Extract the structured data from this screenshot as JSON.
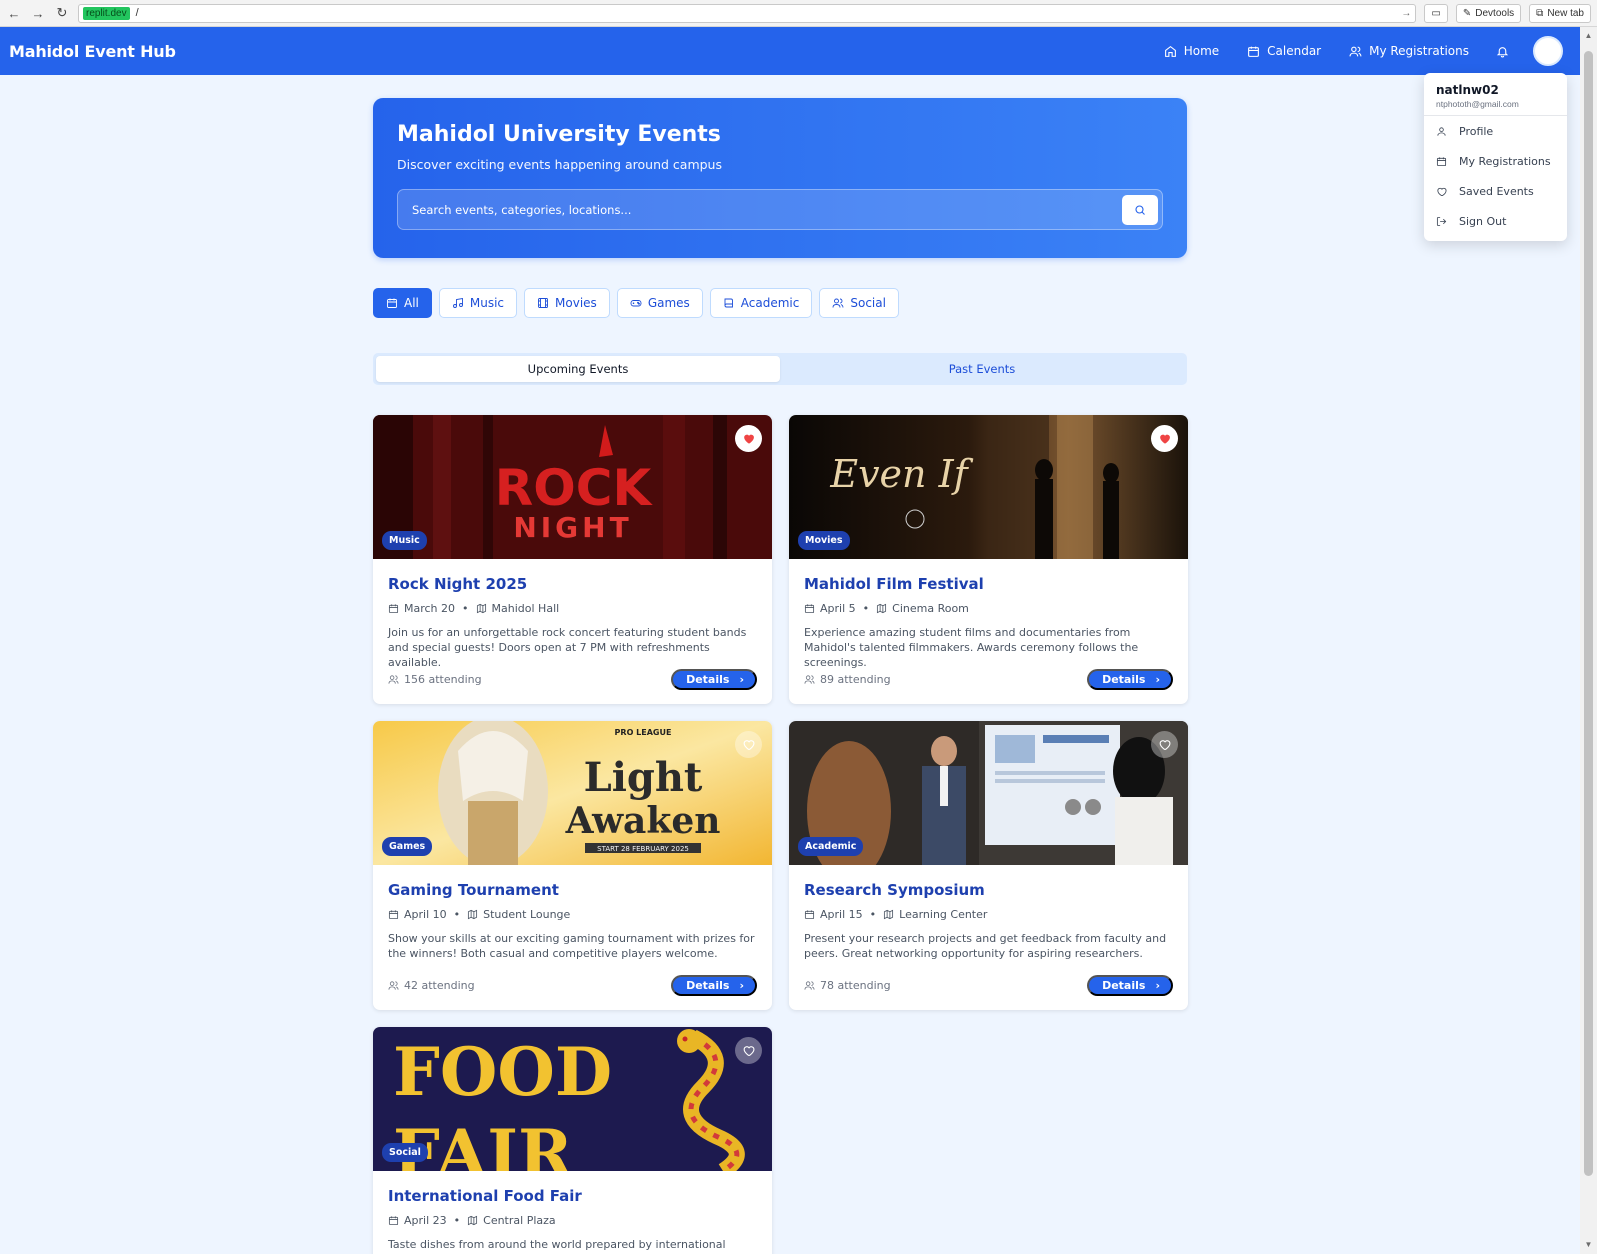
{
  "browser": {
    "url_host": "replit.dev",
    "url_path": "/",
    "devtools_label": "Devtools",
    "newtab_label": "New tab"
  },
  "header": {
    "brand": "Mahidol Event Hub",
    "nav": [
      {
        "label": "Home",
        "icon": "home-icon"
      },
      {
        "label": "Calendar",
        "icon": "calendar-icon"
      },
      {
        "label": "My Registrations",
        "icon": "users-icon"
      }
    ]
  },
  "hero": {
    "title": "Mahidol University Events",
    "subtitle": "Discover exciting events happening around campus",
    "search_placeholder": "Search events, categories, locations..."
  },
  "categories": [
    {
      "label": "All",
      "active": true
    },
    {
      "label": "Music"
    },
    {
      "label": "Movies"
    },
    {
      "label": "Games"
    },
    {
      "label": "Academic"
    },
    {
      "label": "Social"
    }
  ],
  "tabs": [
    {
      "label": "Upcoming Events",
      "active": true
    },
    {
      "label": "Past Events"
    }
  ],
  "events": [
    {
      "title": "Rock Night 2025",
      "category": "Music",
      "date": "March 20",
      "location": "Mahidol Hall",
      "description": "Join us for an unforgettable rock concert featuring student bands and special guests! Doors open at 7 PM with refreshments available.",
      "attending": "156 attending",
      "saved": true,
      "details_label": "Details",
      "image_text": [
        "ROCK",
        "NIGHT"
      ]
    },
    {
      "title": "Mahidol Film Festival",
      "category": "Movies",
      "date": "April 5",
      "location": "Cinema Room",
      "description": "Experience amazing student films and documentaries from Mahidol's talented filmmakers. Awards ceremony follows the screenings.",
      "attending": "89 attending",
      "saved": true,
      "details_label": "Details",
      "image_text": [
        "Even If"
      ]
    },
    {
      "title": "Gaming Tournament",
      "category": "Games",
      "date": "April 10",
      "location": "Student Lounge",
      "description": "Show your skills at our exciting gaming tournament with prizes for the winners! Both casual and competitive players welcome.",
      "attending": "42 attending",
      "saved": false,
      "details_label": "Details",
      "image_text": [
        "PRO LEAGUE",
        "Light",
        "Awaken",
        "START 28 FEBRUARY 2025"
      ]
    },
    {
      "title": "Research Symposium",
      "category": "Academic",
      "date": "April 15",
      "location": "Learning Center",
      "description": "Present your research projects and get feedback from faculty and peers. Great networking opportunity for aspiring researchers.",
      "attending": "78 attending",
      "saved": false,
      "details_label": "Details",
      "image_text": []
    },
    {
      "title": "International Food Fair",
      "category": "Social",
      "date": "April 23",
      "location": "Central Plaza",
      "description": "Taste dishes from around the world prepared by international students. Cultural",
      "attending": "",
      "saved": false,
      "details_label": "Details",
      "image_text": [
        "FOOD",
        "FAIR"
      ]
    }
  ],
  "user_menu": {
    "name": "natlnw02",
    "email": "ntphototh@gmail.com",
    "items": [
      {
        "label": "Profile",
        "icon": "user-icon"
      },
      {
        "label": "My Registrations",
        "icon": "calendar-icon"
      },
      {
        "label": "Saved Events",
        "icon": "heart-icon"
      },
      {
        "label": "Sign Out",
        "icon": "logout-icon"
      }
    ]
  },
  "colors": {
    "primary": "#2563eb",
    "title_blue": "#1e40af",
    "page_bg": "#eef5ff",
    "heart_red": "#ef4444"
  }
}
